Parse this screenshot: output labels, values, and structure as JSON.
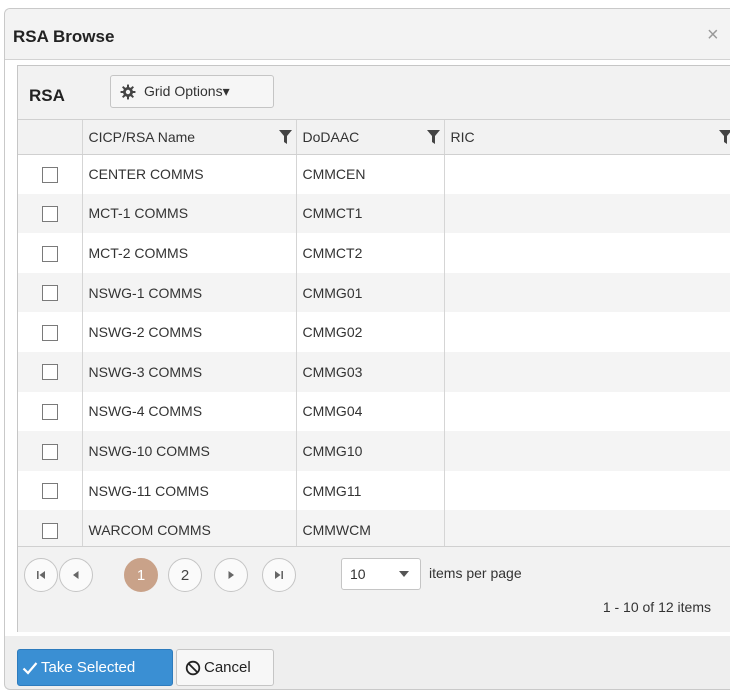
{
  "dialog": {
    "title": "RSA Browse",
    "close_glyph": "×"
  },
  "grid": {
    "title": "RSA",
    "grid_options_label": "Grid Options▾",
    "columns": [
      "CICP/RSA Name",
      "DoDAAC",
      "RIC"
    ],
    "rows": [
      {
        "name": "CENTER COMMS",
        "dodaac": "CMMCEN",
        "ric": ""
      },
      {
        "name": "MCT-1 COMMS",
        "dodaac": "CMMCT1",
        "ric": ""
      },
      {
        "name": "MCT-2 COMMS",
        "dodaac": "CMMCT2",
        "ric": ""
      },
      {
        "name": "NSWG-1 COMMS",
        "dodaac": "CMMG01",
        "ric": ""
      },
      {
        "name": "NSWG-2 COMMS",
        "dodaac": "CMMG02",
        "ric": ""
      },
      {
        "name": "NSWG-3 COMMS",
        "dodaac": "CMMG03",
        "ric": ""
      },
      {
        "name": "NSWG-4 COMMS",
        "dodaac": "CMMG04",
        "ric": ""
      },
      {
        "name": "NSWG-10 COMMS",
        "dodaac": "CMMG10",
        "ric": ""
      },
      {
        "name": "NSWG-11 COMMS",
        "dodaac": "CMMG11",
        "ric": ""
      },
      {
        "name": "WARCOM COMMS",
        "dodaac": "CMMWCM",
        "ric": ""
      }
    ]
  },
  "pager": {
    "pages": [
      "1",
      "2"
    ],
    "current_page": "1",
    "page_size": "10",
    "items_per_page_label": "items per page",
    "summary": "1 - 10 of 12 items"
  },
  "footer": {
    "take_selected_label": "Take Selected",
    "cancel_label": "Cancel"
  },
  "colors": {
    "accent": "#3a8fd3",
    "active_page": "#c9a289"
  },
  "icons": [
    "gear-icon",
    "filter-icon",
    "close-icon",
    "first-page-icon",
    "prev-page-icon",
    "next-page-icon",
    "last-page-icon",
    "dropdown-arrow-icon",
    "checkmark-icon",
    "cancel-icon"
  ]
}
